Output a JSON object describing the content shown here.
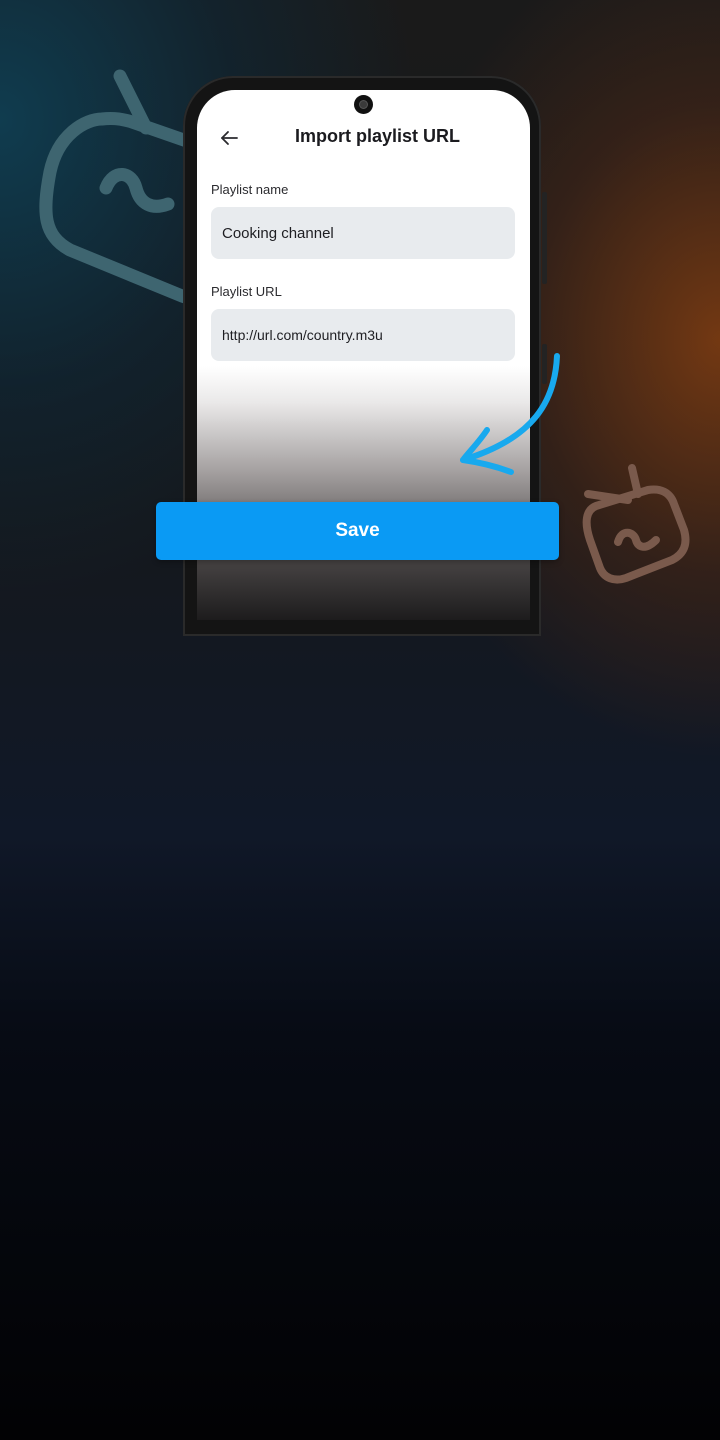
{
  "screen": {
    "title": "Import playlist URL",
    "back_icon": "arrow-left-icon"
  },
  "form": {
    "name_label": "Playlist name",
    "name_value": "Cooking channel",
    "url_label": "Playlist URL",
    "url_value": "http://url.com/country.m3u"
  },
  "actions": {
    "save_label": "Save"
  },
  "colors": {
    "accent": "#0a9af4",
    "arrow": "#18a9ee",
    "input_bg": "#e8ebee",
    "deco_tv_big": "#3e6570",
    "deco_tv_small": "#7a5a4c"
  },
  "decorations": {
    "icons": [
      "tv-icon",
      "tv-icon",
      "curved-arrow-icon"
    ]
  }
}
